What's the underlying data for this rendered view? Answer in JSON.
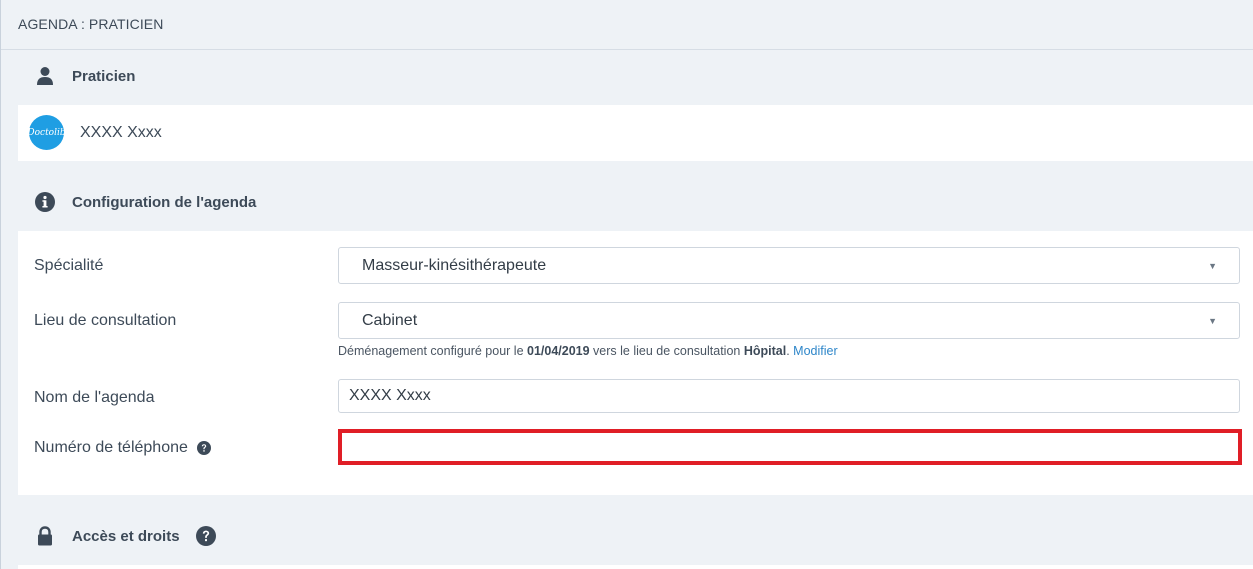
{
  "header": {
    "title": "AGENDA : PRATICIEN"
  },
  "practitioner_section": {
    "icon": "user-icon",
    "title": "Praticien",
    "avatar_text": "Doctolib",
    "name": "XXXX Xxxx"
  },
  "config_section": {
    "icon": "info-icon",
    "title": "Configuration de l'agenda",
    "speciality": {
      "label": "Spécialité",
      "value": "Masseur-kinésithérapeute"
    },
    "location": {
      "label": "Lieu de consultation",
      "value": "Cabinet",
      "hint_prefix": "Déménagement configuré pour le ",
      "hint_date": "01/04/2019",
      "hint_middle": " vers le lieu de consultation ",
      "hint_place": "Hôpital",
      "hint_suffix": ". ",
      "hint_link": "Modifier"
    },
    "agenda_name": {
      "label": "Nom de l'agenda",
      "value": "XXXX Xxxx"
    },
    "phone": {
      "label": "Numéro de téléphone",
      "value": "",
      "help_icon": "question-circle-icon",
      "highlight_color": "#e01e26"
    }
  },
  "access_section": {
    "icon": "lock-icon",
    "title": "Accès et droits",
    "help_icon": "question-circle-icon"
  },
  "colors": {
    "background": "#eef2f6",
    "text": "#3d4a58",
    "link": "#2e86c9",
    "avatar": "#1f9ee3"
  }
}
